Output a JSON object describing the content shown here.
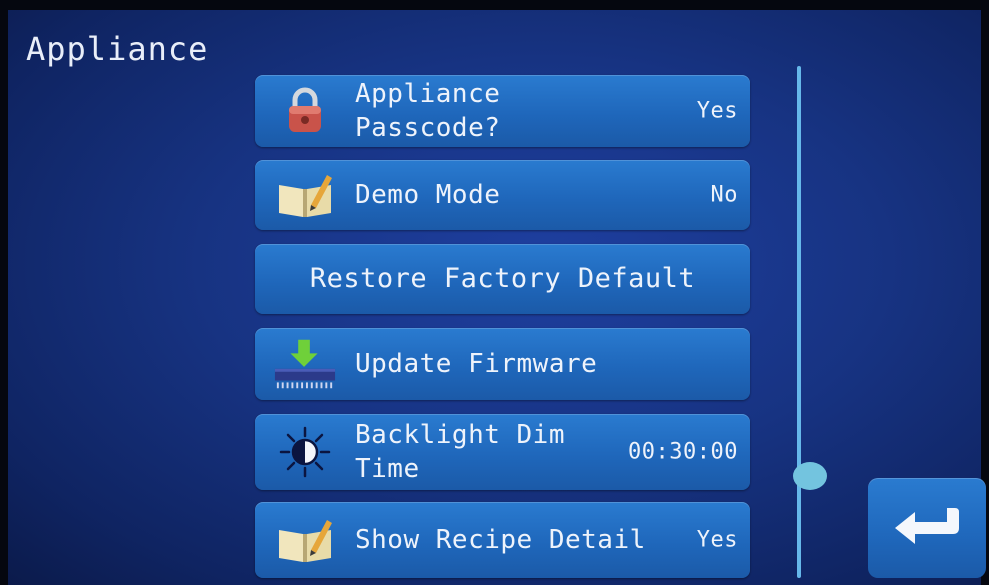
{
  "header": {
    "title": "Appliance"
  },
  "settings": [
    {
      "label": "Appliance\nPasscode?",
      "value": "Yes",
      "icon": "padlock-icon"
    },
    {
      "label": "Demo Mode",
      "value": "No",
      "icon": "book-pencil-icon"
    },
    {
      "label": "Restore Factory Default",
      "value": "",
      "icon": ""
    },
    {
      "label": "Update Firmware",
      "value": "",
      "icon": "firmware-download-icon"
    },
    {
      "label": "Backlight Dim\nTime",
      "value": "00:30:00",
      "icon": "contrast-sun-icon"
    },
    {
      "label": "Show Recipe Detail",
      "value": "Yes",
      "icon": "book-pencil-icon"
    }
  ],
  "colors": {
    "background": "#173382",
    "row": "#1f67bb",
    "text": "#eef3fb",
    "scrollbar": "#66b8ea",
    "scroll_thumb": "#73c4df"
  },
  "scrollbar": {
    "position": 0.8
  },
  "back_button": {
    "icon": "return-arrow-icon"
  }
}
